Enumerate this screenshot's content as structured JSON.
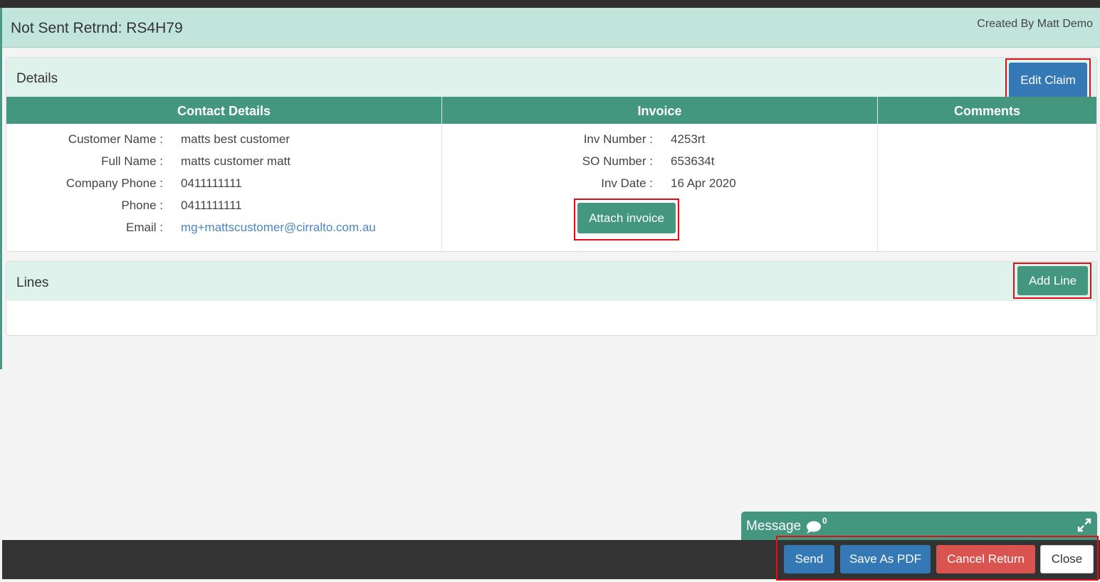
{
  "header": {
    "title": "Not Sent Retrnd: RS4H79",
    "created_by": "Created By Matt Demo"
  },
  "details": {
    "title": "Details",
    "edit_button": "Edit Claim",
    "contact": {
      "heading": "Contact Details",
      "fields": [
        {
          "label": "Customer Name :",
          "value": "matts best customer"
        },
        {
          "label": "Full Name :",
          "value": "matts customer matt"
        },
        {
          "label": "Company Phone :",
          "value": "0411111111"
        },
        {
          "label": "Phone :",
          "value": "0411111111"
        },
        {
          "label": "Email :",
          "value": "mg+mattscustomer@cirralto.com.au"
        }
      ]
    },
    "invoice": {
      "heading": "Invoice",
      "fields": [
        {
          "label": "Inv Number :",
          "value": "4253rt"
        },
        {
          "label": "SO Number :",
          "value": "653634t"
        },
        {
          "label": "Inv Date :",
          "value": "16 Apr 2020"
        }
      ],
      "attach_button": "Attach invoice"
    },
    "comments": {
      "heading": "Comments"
    }
  },
  "lines": {
    "title": "Lines",
    "add_button": "Add Line"
  },
  "message": {
    "label": "Message",
    "count": "0"
  },
  "footer": {
    "send": "Send",
    "save_pdf": "Save As PDF",
    "cancel_return": "Cancel Return",
    "close": "Close"
  },
  "colors": {
    "header_bg": "#c1e5da",
    "panel_head_bg": "#dff2eb",
    "accent_green": "#43977f",
    "primary_blue": "#3478b5",
    "danger_red": "#d9534f",
    "footer_bg": "#333333",
    "highlight_red": "#e10e17"
  }
}
